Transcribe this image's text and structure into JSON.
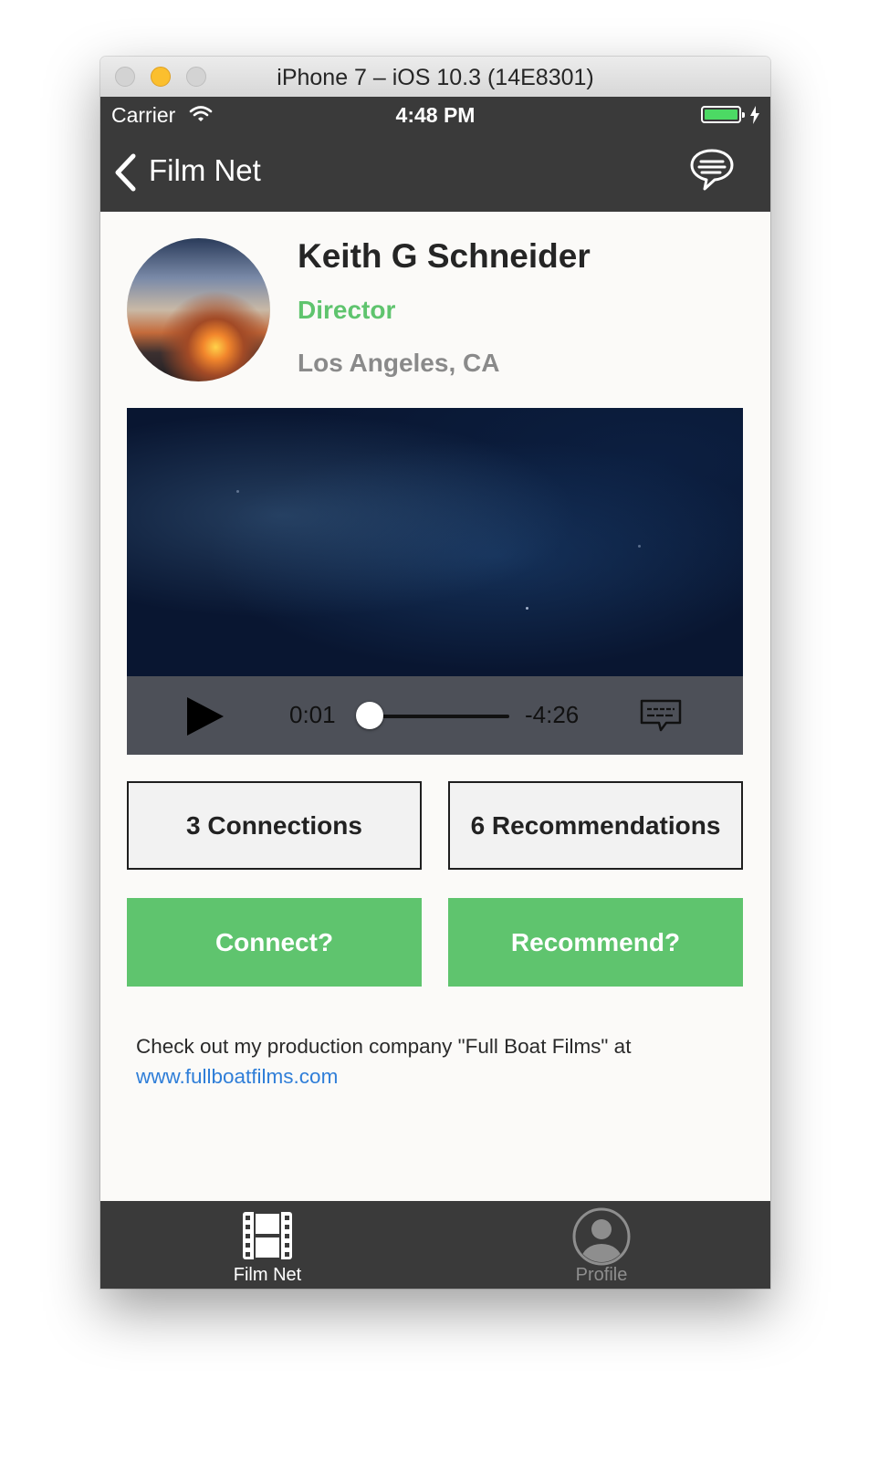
{
  "window": {
    "title": "iPhone 7 – iOS 10.3 (14E8301)"
  },
  "status_bar": {
    "carrier": "Carrier",
    "time": "4:48 PM"
  },
  "nav": {
    "back_label": "Film Net"
  },
  "profile": {
    "name": "Keith G Schneider",
    "role": "Director",
    "location": "Los Angeles, CA"
  },
  "player": {
    "elapsed": "0:01",
    "remaining": "-4:26",
    "progress": 0.004
  },
  "stats": {
    "connections": "3 Connections",
    "recommendations": "6 Recommendations"
  },
  "actions": {
    "connect": "Connect?",
    "recommend": "Recommend?"
  },
  "bio": {
    "text": "Check out my production company \"Full Boat Films\" at",
    "link": "www.fullboatfilms.com"
  },
  "tabs": [
    {
      "label": "Film Net",
      "icon": "film-strip-icon",
      "selected": true
    },
    {
      "label": "Profile",
      "icon": "profile-icon",
      "selected": false
    }
  ],
  "colors": {
    "accent_green": "#5fc46e",
    "bar_dark": "#3a3a3a",
    "link_blue": "#2f7ed8",
    "tab_selected": "#ffffff",
    "tab_unselected": "#8e8e8e"
  }
}
